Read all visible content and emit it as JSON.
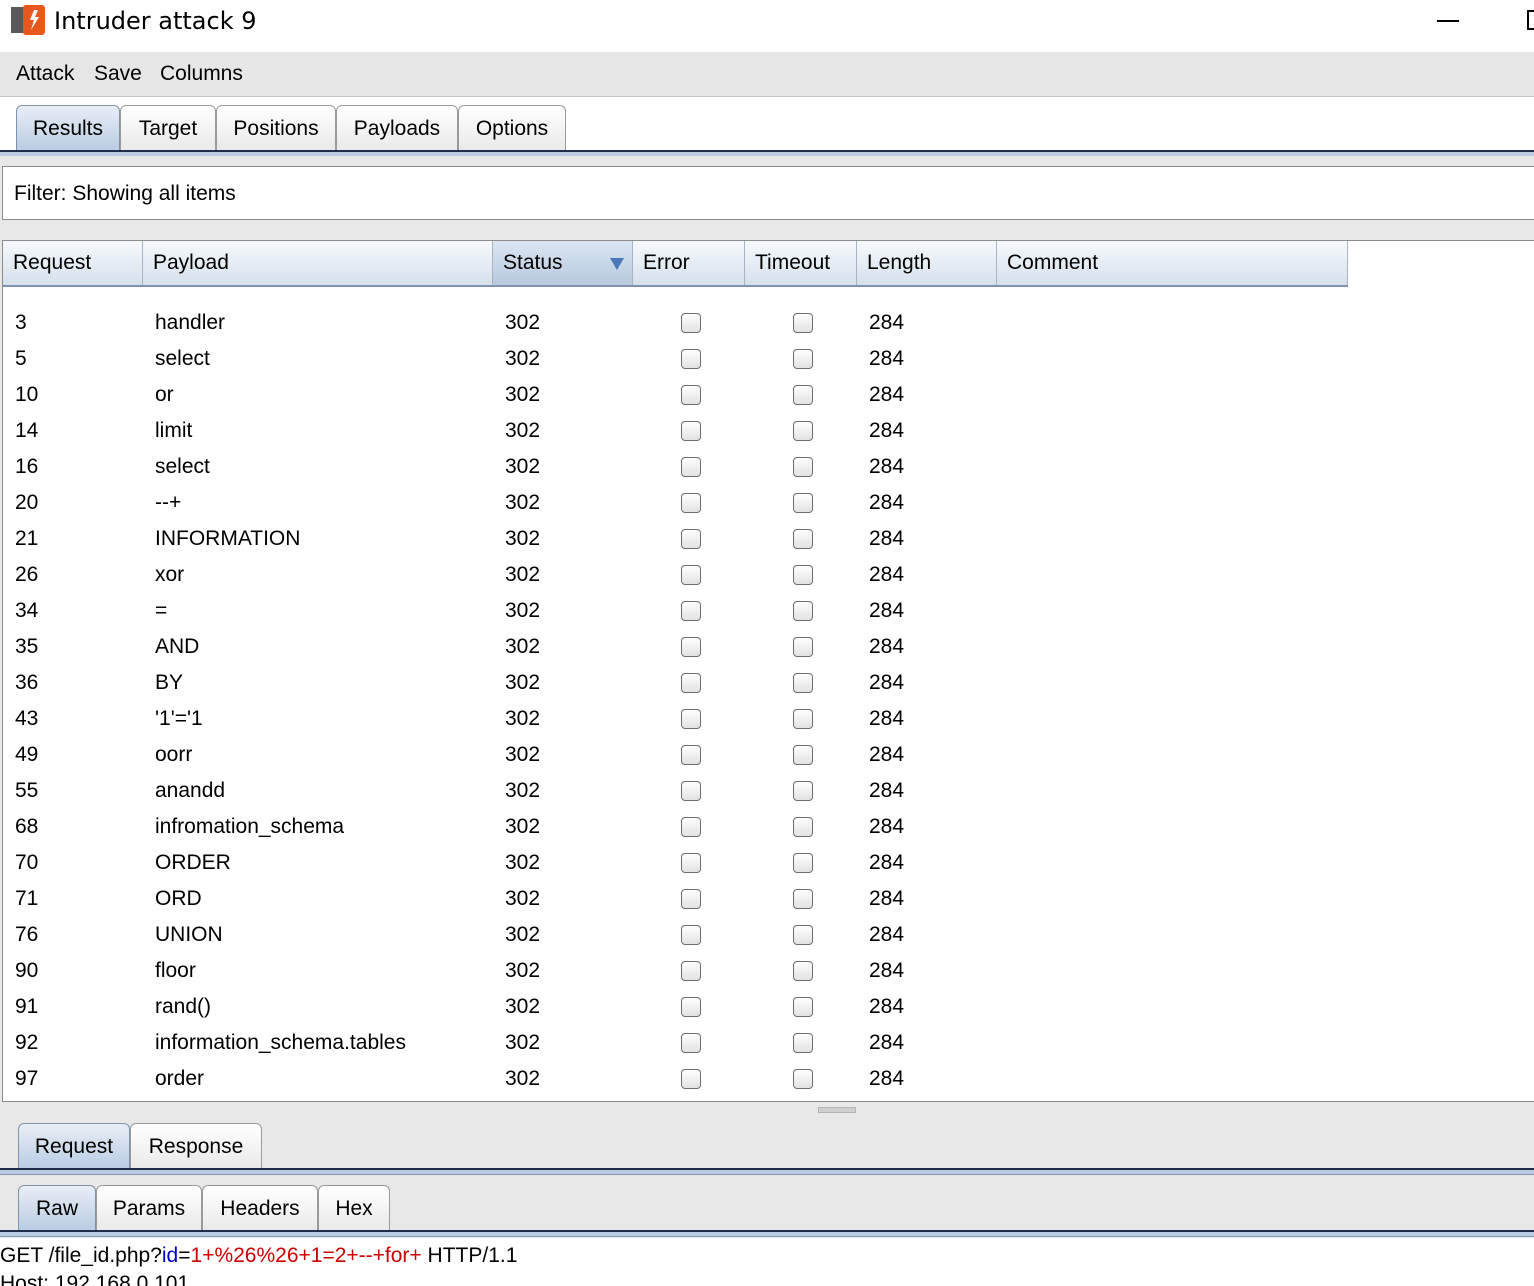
{
  "window": {
    "title": "Intruder attack 9"
  },
  "menu": [
    "Attack",
    "Save",
    "Columns"
  ],
  "main_tabs": [
    "Results",
    "Target",
    "Positions",
    "Payloads",
    "Options"
  ],
  "main_tabs_active": "Results",
  "filter": {
    "text": "Filter:  Showing all items"
  },
  "table": {
    "columns": [
      "Request",
      "Payload",
      "Status",
      "Error",
      "Timeout",
      "Length",
      "Comment"
    ],
    "sorted_column": "Status",
    "rows": [
      {
        "request": "3",
        "payload": "handler",
        "status": "302",
        "error": false,
        "timeout": false,
        "length": "284",
        "comment": ""
      },
      {
        "request": "5",
        "payload": "select",
        "status": "302",
        "error": false,
        "timeout": false,
        "length": "284",
        "comment": ""
      },
      {
        "request": "10",
        "payload": "or",
        "status": "302",
        "error": false,
        "timeout": false,
        "length": "284",
        "comment": ""
      },
      {
        "request": "14",
        "payload": "limit",
        "status": "302",
        "error": false,
        "timeout": false,
        "length": "284",
        "comment": ""
      },
      {
        "request": "16",
        "payload": "select",
        "status": "302",
        "error": false,
        "timeout": false,
        "length": "284",
        "comment": ""
      },
      {
        "request": "20",
        "payload": "--+",
        "status": "302",
        "error": false,
        "timeout": false,
        "length": "284",
        "comment": ""
      },
      {
        "request": "21",
        "payload": "INFORMATION",
        "status": "302",
        "error": false,
        "timeout": false,
        "length": "284",
        "comment": ""
      },
      {
        "request": "26",
        "payload": "xor",
        "status": "302",
        "error": false,
        "timeout": false,
        "length": "284",
        "comment": ""
      },
      {
        "request": "34",
        "payload": "=",
        "status": "302",
        "error": false,
        "timeout": false,
        "length": "284",
        "comment": ""
      },
      {
        "request": "35",
        "payload": "AND",
        "status": "302",
        "error": false,
        "timeout": false,
        "length": "284",
        "comment": ""
      },
      {
        "request": "36",
        "payload": "BY",
        "status": "302",
        "error": false,
        "timeout": false,
        "length": "284",
        "comment": ""
      },
      {
        "request": "43",
        "payload": "'1'='1",
        "status": "302",
        "error": false,
        "timeout": false,
        "length": "284",
        "comment": ""
      },
      {
        "request": "49",
        "payload": "oorr",
        "status": "302",
        "error": false,
        "timeout": false,
        "length": "284",
        "comment": ""
      },
      {
        "request": "55",
        "payload": "anandd",
        "status": "302",
        "error": false,
        "timeout": false,
        "length": "284",
        "comment": ""
      },
      {
        "request": "68",
        "payload": "infromation_schema",
        "status": "302",
        "error": false,
        "timeout": false,
        "length": "284",
        "comment": ""
      },
      {
        "request": "70",
        "payload": "ORDER",
        "status": "302",
        "error": false,
        "timeout": false,
        "length": "284",
        "comment": ""
      },
      {
        "request": "71",
        "payload": "ORD",
        "status": "302",
        "error": false,
        "timeout": false,
        "length": "284",
        "comment": ""
      },
      {
        "request": "76",
        "payload": "UNION",
        "status": "302",
        "error": false,
        "timeout": false,
        "length": "284",
        "comment": ""
      },
      {
        "request": "90",
        "payload": "floor",
        "status": "302",
        "error": false,
        "timeout": false,
        "length": "284",
        "comment": ""
      },
      {
        "request": "91",
        "payload": "rand()",
        "status": "302",
        "error": false,
        "timeout": false,
        "length": "284",
        "comment": ""
      },
      {
        "request": "92",
        "payload": "information_schema.tables",
        "status": "302",
        "error": false,
        "timeout": false,
        "length": "284",
        "comment": ""
      },
      {
        "request": "97",
        "payload": "order",
        "status": "302",
        "error": false,
        "timeout": false,
        "length": "284",
        "comment": ""
      }
    ]
  },
  "detail_tabs": [
    "Request",
    "Response"
  ],
  "detail_tabs_active": "Request",
  "view_tabs": [
    "Raw",
    "Params",
    "Headers",
    "Hex"
  ],
  "view_tabs_active": "Raw",
  "request_text": {
    "line1_method": "GET /file_id.php?",
    "line1_param": "id",
    "line1_eq": "=",
    "line1_value": "1+%26%26+1=2+--+for+",
    "line1_protocol": " HTTP/1.1",
    "line2": "Host: 192.168.0.101"
  },
  "colors": {
    "tab_active": "#b9cce2",
    "param_name": "#0000cc",
    "param_value": "#cc0000",
    "sort_arrow": "#4a78b8"
  }
}
